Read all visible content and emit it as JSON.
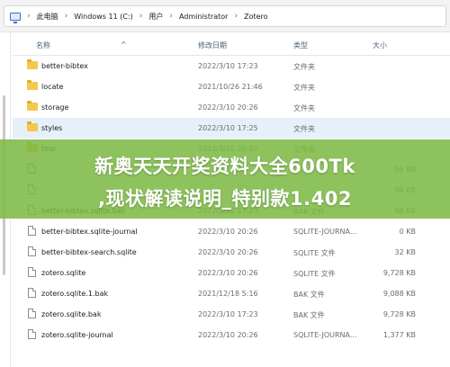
{
  "address_bar": {
    "crumbs": [
      "此电脑",
      "Windows 11 (C:)",
      "用户",
      "Administrator",
      "Zotero"
    ]
  },
  "columns": {
    "name": "名称",
    "date": "修改日期",
    "type": "类型",
    "size": "大小"
  },
  "rows": [
    {
      "name": "better-bibtex",
      "date": "2022/3/10 17:23",
      "type": "文件夹",
      "size": "",
      "kind": "folder"
    },
    {
      "name": "locate",
      "date": "2021/10/26 21:46",
      "type": "文件夹",
      "size": "",
      "kind": "folder"
    },
    {
      "name": "storage",
      "date": "2022/3/10 20:26",
      "type": "文件夹",
      "size": "",
      "kind": "folder"
    },
    {
      "name": "styles",
      "date": "2022/3/10 17:25",
      "type": "文件夹",
      "size": "",
      "kind": "folder"
    },
    {
      "name": "tmp",
      "date": "2022/3/10 20:27",
      "type": "文件夹",
      "size": "",
      "kind": "folder"
    },
    {
      "name": "",
      "date": "",
      "type": "",
      "size": "96 KB",
      "kind": "file"
    },
    {
      "name": "",
      "date": "",
      "type": "",
      "size": "96 KB",
      "kind": "file"
    },
    {
      "name": "better-bibtex.sqlite.bak",
      "date": "2022/3/10 17:23",
      "type": "BAK 文件",
      "size": "96 KB",
      "kind": "file"
    },
    {
      "name": "better-bibtex.sqlite-journal",
      "date": "2022/3/10 20:26",
      "type": "SQLITE-JOURNA...",
      "size": "0 KB",
      "kind": "file"
    },
    {
      "name": "better-bibtex-search.sqlite",
      "date": "2022/3/10 20:26",
      "type": "SQLITE 文件",
      "size": "32 KB",
      "kind": "file"
    },
    {
      "name": "zotero.sqlite",
      "date": "2022/3/10 20:26",
      "type": "SQLITE 文件",
      "size": "9,728 KB",
      "kind": "file"
    },
    {
      "name": "zotero.sqlite.1.bak",
      "date": "2021/12/18 5:16",
      "type": "BAK 文件",
      "size": "9,088 KB",
      "kind": "file"
    },
    {
      "name": "zotero.sqlite.bak",
      "date": "2022/3/10 17:23",
      "type": "BAK 文件",
      "size": "9,728 KB",
      "kind": "file"
    },
    {
      "name": "zotero.sqlite-journal",
      "date": "2022/3/10 20:26",
      "type": "SQLITE-JOURNA...",
      "size": "1,377 KB",
      "kind": "file"
    }
  ],
  "selected_row": 3,
  "watermark": {
    "line1": "新奥天天开奖资料大全600Tk",
    "line2": ",现状解读说明_特别款1.402"
  },
  "colors": {
    "selection": "#e5f0fb",
    "banner": "#7cb842"
  }
}
